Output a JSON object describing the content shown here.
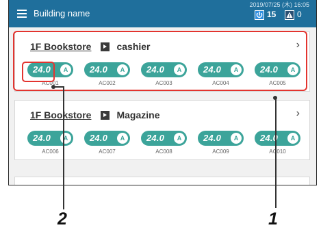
{
  "app": {
    "title": "Building name",
    "datetime": "2019/07/25 (木) 16:05",
    "run_count": "15",
    "alarm_count": "0"
  },
  "groups": [
    {
      "location": "1F Bookstore",
      "name": "cashier",
      "units": [
        {
          "temp": "24.0",
          "mode": "A",
          "name": "AC001"
        },
        {
          "temp": "24.0",
          "mode": "A",
          "name": "AC002"
        },
        {
          "temp": "24.0",
          "mode": "A",
          "name": "AC003"
        },
        {
          "temp": "24.0",
          "mode": "A",
          "name": "AC004"
        },
        {
          "temp": "24.0",
          "mode": "A",
          "name": "AC005"
        }
      ]
    },
    {
      "location": "1F Bookstore",
      "name": "Magazine",
      "units": [
        {
          "temp": "24.0",
          "mode": "A",
          "name": "AC006"
        },
        {
          "temp": "24.0",
          "mode": "A",
          "name": "AC007"
        },
        {
          "temp": "24.0",
          "mode": "A",
          "name": "AC008"
        },
        {
          "temp": "24.0",
          "mode": "A",
          "name": "AC009"
        },
        {
          "temp": "24.0",
          "mode": "A",
          "name": "AC010"
        }
      ]
    }
  ],
  "callouts": {
    "one": "1",
    "two": "2"
  },
  "colors": {
    "topbar": "#1f6f9c",
    "unit_pill": "#3ca49a",
    "callout": "#e3342f"
  },
  "icons": {
    "menu": "hamburger-menu-icon",
    "run": "power-icon",
    "alarm": "alarm-icon",
    "nav": "chevron-right-icon"
  }
}
